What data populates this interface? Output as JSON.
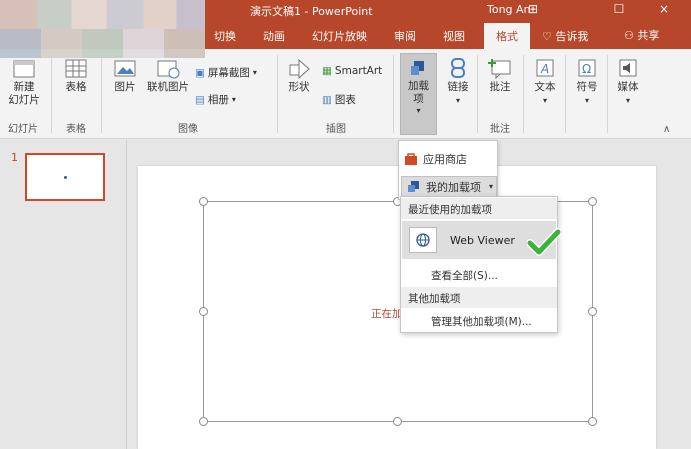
{
  "titlebar": {
    "doc_title": "演示文稿1 - PowerPoint",
    "user": "Tong An",
    "restore_glyph": "⊞",
    "maximize_glyph": "☐",
    "close_glyph": "×"
  },
  "tabs": [
    {
      "label": "切换"
    },
    {
      "label": "动画"
    },
    {
      "label": "幻灯片放映"
    },
    {
      "label": "审阅"
    },
    {
      "label": "视图"
    },
    {
      "label": "格式"
    }
  ],
  "tell_me": "告诉我",
  "share": "共享",
  "ribbon": {
    "new_slide": "新建\n幻灯片",
    "slides_group": "幻灯片",
    "table": "表格",
    "tables_group": "表格",
    "picture": "图片",
    "online_picture": "联机图片",
    "screenshot": "屏幕截图",
    "album": "相册",
    "images_group": "图像",
    "shapes": "形状",
    "smartart": "SmartArt",
    "chart": "图表",
    "illustrations_group": "插图",
    "addins": "加载\n项",
    "link": "链接",
    "comment": "批注",
    "comments_group": "批注",
    "text": "文本",
    "symbol": "符号",
    "media": "媒体"
  },
  "thumbnails": {
    "slide_number": "1"
  },
  "slide": {
    "loading_text": "正在加"
  },
  "store_menu": {
    "store": "应用商店",
    "my_addins": "我的加载项"
  },
  "submenu": {
    "recent_header": "最近使用的加载项",
    "web_viewer": "Web Viewer",
    "view_all": "查看全部(S)...",
    "other_header": "其他加载项",
    "manage": "管理其他加载项(M)..."
  },
  "colors": {
    "accent": "#b7472a",
    "checkmark": "#3bb33b"
  }
}
